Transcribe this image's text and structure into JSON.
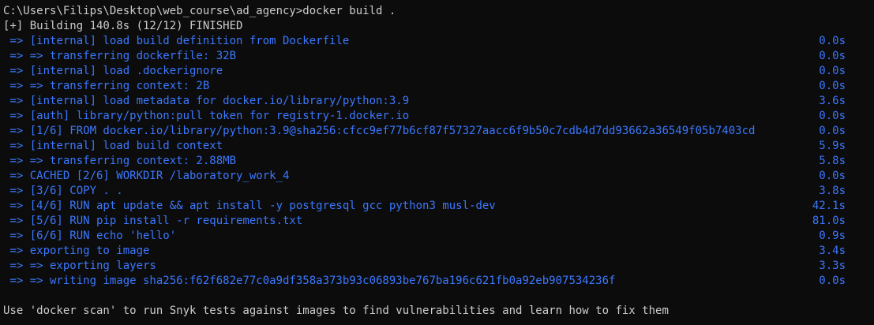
{
  "prompt_line": "C:\\Users\\Filips\\Desktop\\web_course\\ad_agency>docker build .",
  "status_line": "[+] Building 140.8s (12/12) FINISHED",
  "steps": [
    {
      "text": " => [internal] load build definition from Dockerfile",
      "time": "0.0s"
    },
    {
      "text": " => => transferring dockerfile: 32B",
      "time": "0.0s"
    },
    {
      "text": " => [internal] load .dockerignore",
      "time": "0.0s"
    },
    {
      "text": " => => transferring context: 2B",
      "time": "0.0s"
    },
    {
      "text": " => [internal] load metadata for docker.io/library/python:3.9",
      "time": "3.6s"
    },
    {
      "text": " => [auth] library/python:pull token for registry-1.docker.io",
      "time": "0.0s"
    },
    {
      "text": " => [1/6] FROM docker.io/library/python:3.9@sha256:cfcc9ef77b6cf87f57327aacc6f9b50c7cdb4d7dd93662a36549f05b7403cd",
      "time": "0.0s"
    },
    {
      "text": " => [internal] load build context",
      "time": "5.9s"
    },
    {
      "text": " => => transferring context: 2.88MB",
      "time": "5.8s"
    },
    {
      "text": " => CACHED [2/6] WORKDIR /laboratory_work_4",
      "time": "0.0s"
    },
    {
      "text": " => [3/6] COPY . .",
      "time": "3.8s"
    },
    {
      "text": " => [4/6] RUN apt update && apt install -y postgresql gcc python3 musl-dev",
      "time": "42.1s"
    },
    {
      "text": " => [5/6] RUN pip install -r requirements.txt",
      "time": "81.0s"
    },
    {
      "text": " => [6/6] RUN echo 'hello'",
      "time": "0.9s"
    },
    {
      "text": " => exporting to image",
      "time": "3.4s"
    },
    {
      "text": " => => exporting layers",
      "time": "3.3s"
    },
    {
      "text": " => => writing image sha256:f62f682e77c0a9df358a373b93c06893be767ba196c621fb0a92eb907534236f",
      "time": "0.0s"
    }
  ],
  "footer_line": "Use 'docker scan' to run Snyk tests against images to find vulnerabilities and learn how to fix them",
  "colors": {
    "background": "#0c0c0c",
    "text": "#cccccc",
    "step_text": "#3b78ff"
  }
}
